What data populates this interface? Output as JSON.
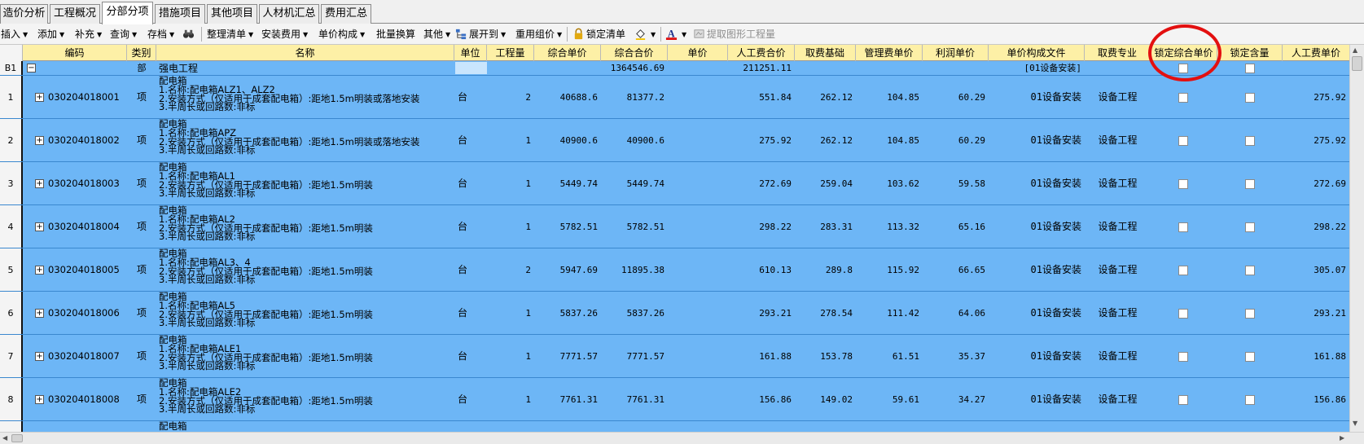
{
  "tabs": [
    "造价分析",
    "工程概况",
    "分部分项",
    "措施项目",
    "其他项目",
    "人材机汇总",
    "费用汇总"
  ],
  "active_tab": "分部分项",
  "toolbar": {
    "insert": "插入",
    "add": "添加",
    "supplement": "补充",
    "query": "查询",
    "save": "存档",
    "organize": "整理清单",
    "install_fee": "安装费用",
    "unit_price_comp": "单价构成",
    "batch_convert": "批量换算",
    "other": "其他",
    "expand_to": "展开到",
    "reuse_price": "重用组价",
    "lock_list": "锁定清单",
    "extract_qty": "提取图形工程量"
  },
  "columns": [
    "编码",
    "类别",
    "名称",
    "单位",
    "工程量",
    "综合单价",
    "综合合价",
    "单价",
    "人工费合价",
    "取费基础",
    "管理费单价",
    "利润单价",
    "单价构成文件",
    "取费专业",
    "锁定综合单价",
    "锁定含量",
    "人工费单价"
  ],
  "section_row": {
    "id": "B1",
    "type": "部",
    "name": "强电工程",
    "total": "1364546.69",
    "labor_total": "211251.11",
    "fee_file": "[01设备安装]"
  },
  "rows": [
    {
      "no": "1",
      "code": "030204018001",
      "type": "项",
      "desc": "配电箱\n1.名称:配电箱ALZ1、ALZ2\n2.安装方式（仅适用于成套配电箱）:距地1.5m明装或落地安装\n3.半周长或回路数:非标",
      "unit": "台",
      "qty": "2",
      "unit_price": "40688.6",
      "total": "81377.2",
      "labor_total": "551.84",
      "fee_base": "262.12",
      "mgmt": "104.85",
      "profit": "60.29",
      "fee_file": "01设备安装",
      "major": "设备工程",
      "labor_unit": "275.92"
    },
    {
      "no": "2",
      "code": "030204018002",
      "type": "项",
      "desc": "配电箱\n1.名称:配电箱APZ\n2.安装方式（仅适用于成套配电箱）:距地1.5m明装或落地安装\n3.半周长或回路数:非标",
      "unit": "台",
      "qty": "1",
      "unit_price": "40900.6",
      "total": "40900.6",
      "labor_total": "275.92",
      "fee_base": "262.12",
      "mgmt": "104.85",
      "profit": "60.29",
      "fee_file": "01设备安装",
      "major": "设备工程",
      "labor_unit": "275.92"
    },
    {
      "no": "3",
      "code": "030204018003",
      "type": "项",
      "desc": "配电箱\n1.名称:配电箱AL1\n2.安装方式（仅适用于成套配电箱）:距地1.5m明装\n3.半周长或回路数:非标",
      "unit": "台",
      "qty": "1",
      "unit_price": "5449.74",
      "total": "5449.74",
      "labor_total": "272.69",
      "fee_base": "259.04",
      "mgmt": "103.62",
      "profit": "59.58",
      "fee_file": "01设备安装",
      "major": "设备工程",
      "labor_unit": "272.69"
    },
    {
      "no": "4",
      "code": "030204018004",
      "type": "项",
      "desc": "配电箱\n1.名称:配电箱AL2\n2.安装方式（仅适用于成套配电箱）:距地1.5m明装\n3.半周长或回路数:非标",
      "unit": "台",
      "qty": "1",
      "unit_price": "5782.51",
      "total": "5782.51",
      "labor_total": "298.22",
      "fee_base": "283.31",
      "mgmt": "113.32",
      "profit": "65.16",
      "fee_file": "01设备安装",
      "major": "设备工程",
      "labor_unit": "298.22"
    },
    {
      "no": "5",
      "code": "030204018005",
      "type": "项",
      "desc": "配电箱\n1.名称:配电箱AL3、4\n2.安装方式（仅适用于成套配电箱）:距地1.5m明装\n3.半周长或回路数:非标",
      "unit": "台",
      "qty": "2",
      "unit_price": "5947.69",
      "total": "11895.38",
      "labor_total": "610.13",
      "fee_base": "289.8",
      "mgmt": "115.92",
      "profit": "66.65",
      "fee_file": "01设备安装",
      "major": "设备工程",
      "labor_unit": "305.07"
    },
    {
      "no": "6",
      "code": "030204018006",
      "type": "项",
      "desc": "配电箱\n1.名称:配电箱AL5\n2.安装方式（仅适用于成套配电箱）:距地1.5m明装\n3.半周长或回路数:非标",
      "unit": "台",
      "qty": "1",
      "unit_price": "5837.26",
      "total": "5837.26",
      "labor_total": "293.21",
      "fee_base": "278.54",
      "mgmt": "111.42",
      "profit": "64.06",
      "fee_file": "01设备安装",
      "major": "设备工程",
      "labor_unit": "293.21"
    },
    {
      "no": "7",
      "code": "030204018007",
      "type": "项",
      "desc": "配电箱\n1.名称:配电箱ALE1\n2.安装方式（仅适用于成套配电箱）:距地1.5m明装\n3.半周长或回路数:非标",
      "unit": "台",
      "qty": "1",
      "unit_price": "7771.57",
      "total": "7771.57",
      "labor_total": "161.88",
      "fee_base": "153.78",
      "mgmt": "61.51",
      "profit": "35.37",
      "fee_file": "01设备安装",
      "major": "设备工程",
      "labor_unit": "161.88"
    },
    {
      "no": "8",
      "code": "030204018008",
      "type": "项",
      "desc": "配电箱\n1.名称:配电箱ALE2\n2.安装方式（仅适用于成套配电箱）:距地1.5m明装\n3.半周长或回路数:非标",
      "unit": "台",
      "qty": "1",
      "unit_price": "7761.31",
      "total": "7761.31",
      "labor_total": "156.86",
      "fee_base": "149.02",
      "mgmt": "59.61",
      "profit": "34.27",
      "fee_file": "01设备安装",
      "major": "设备工程",
      "labor_unit": "156.86"
    },
    {
      "no": "",
      "code": "",
      "type": "",
      "desc": "配电箱",
      "unit": "",
      "qty": "",
      "unit_price": "",
      "total": "",
      "labor_total": "",
      "fee_base": "",
      "mgmt": "",
      "profit": "",
      "fee_file": "",
      "major": "",
      "labor_unit": ""
    }
  ],
  "colors": {
    "grid_bg": "#6db6f6",
    "header_bg": "#fdf0a6",
    "annotation": "#e31010"
  }
}
